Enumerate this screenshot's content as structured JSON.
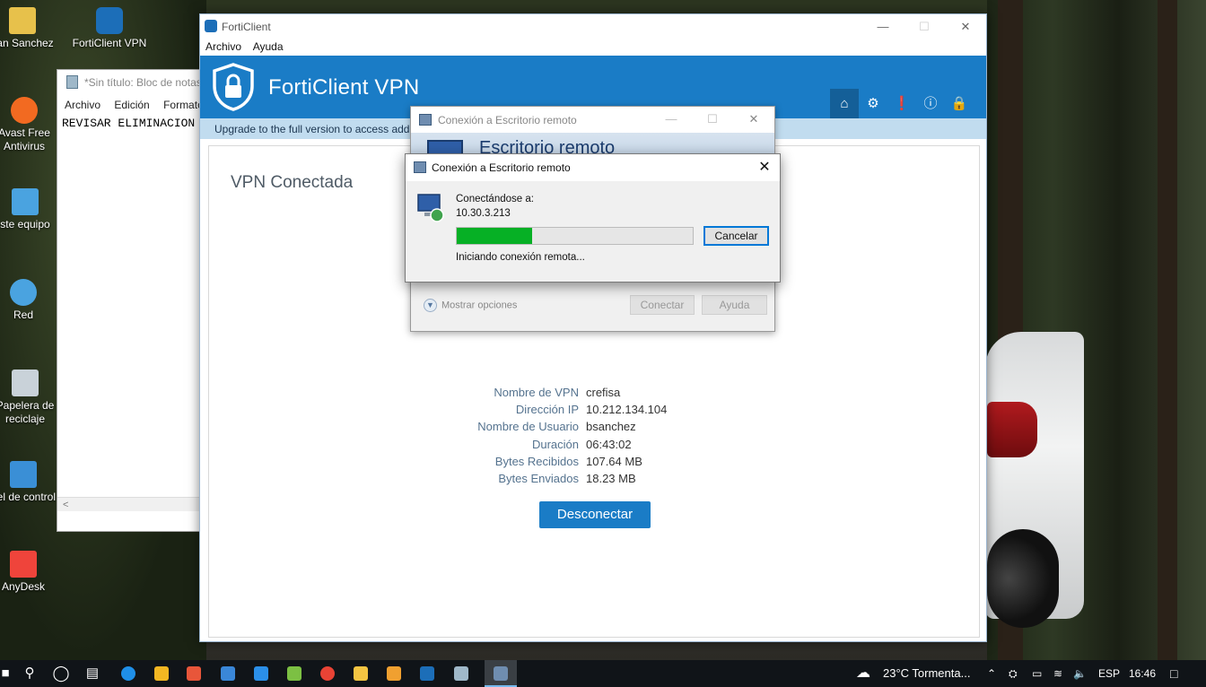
{
  "desktop": {
    "icons": [
      {
        "label": "yan Sanchez",
        "color": "#e7c14b"
      },
      {
        "label": "FortiClient VPN",
        "color": "#1c6eb8"
      },
      {
        "label": "Avast Free Antivirus",
        "color": "#f26a21"
      },
      {
        "label": "ste equipo",
        "color": "#4aa3e0"
      },
      {
        "label": "Red",
        "color": "#4aa3e0"
      },
      {
        "label": "Papelera de reciclaje",
        "color": "#c9d2d9"
      },
      {
        "label": "nel de control",
        "color": "#3a8fd6"
      },
      {
        "label": "AnyDesk",
        "color": "#ef443b"
      }
    ]
  },
  "notepad": {
    "title": "*Sin título: Bloc de notas",
    "menu": [
      "Archivo",
      "Edición",
      "Formato"
    ],
    "content": "REVISAR ELIMINACION",
    "scroll_arrow": "<"
  },
  "forticlient": {
    "window_title": "FortiClient",
    "menu": [
      "Archivo",
      "Ayuda"
    ],
    "header_title": "FortiClient VPN",
    "upgrade_text": "Upgrade to the full version to access additional features and receive technical support.",
    "status": "VPN Conectada",
    "info": [
      {
        "label": "Nombre de VPN",
        "value": "crefisa"
      },
      {
        "label": "Dirección IP",
        "value": "10.212.134.104"
      },
      {
        "label": "Nombre de Usuario",
        "value": "bsanchez"
      },
      {
        "label": "Duración",
        "value": "06:43:02"
      },
      {
        "label": "Bytes Recibidos",
        "value": "107.64 MB"
      },
      {
        "label": "Bytes Enviados",
        "value": "18.23 MB"
      }
    ],
    "disconnect_label": "Desconectar",
    "accent": "#1a7cc6"
  },
  "rdp_main": {
    "title": "Conexión a Escritorio remoto",
    "banner": "Escritorio remoto",
    "options": "Mostrar opciones",
    "connect_label": "Conectar",
    "help_label": "Ayuda"
  },
  "rdp_connecting": {
    "title": "Conexión a Escritorio remoto",
    "connecting_label": "Conectándose a:",
    "ip": "10.30.3.213",
    "progress": 0.32,
    "cancel_label": "Cancelar",
    "status": "Iniciando conexión remota..."
  },
  "taskbar": {
    "weather": "23°C  Tormenta...",
    "lang": "ESP",
    "time": "16:46"
  }
}
